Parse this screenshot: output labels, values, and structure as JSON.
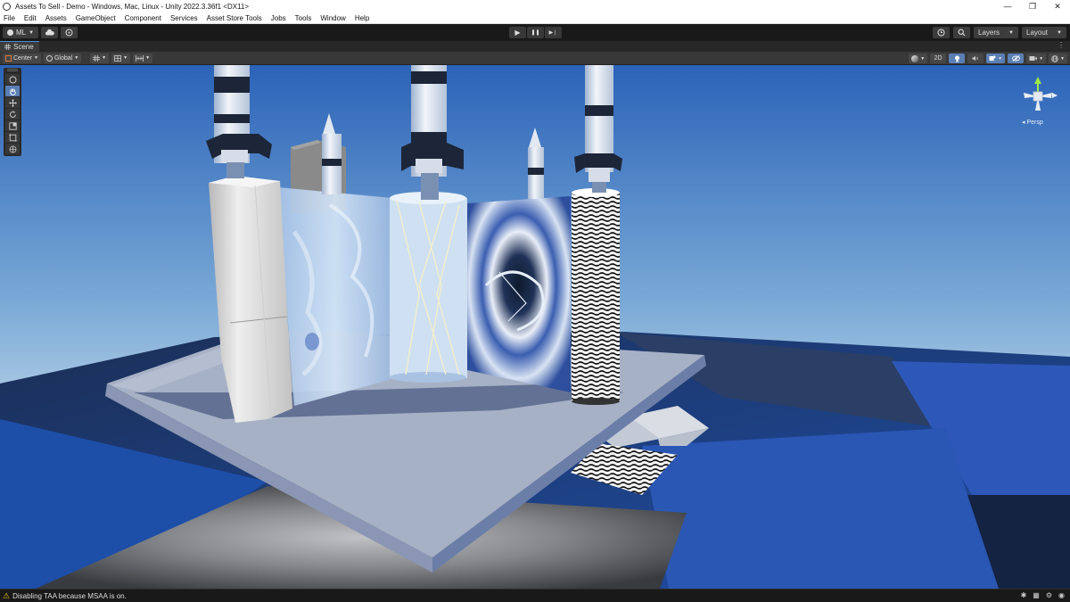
{
  "window": {
    "title": "Assets To Sell - Demo - Windows, Mac, Linux - Unity 2022.3.36f1 <DX11>",
    "minimize": "—",
    "restore": "❐",
    "close": "✕"
  },
  "menu": [
    "File",
    "Edit",
    "Assets",
    "GameObject",
    "Component",
    "Services",
    "Asset Store Tools",
    "Jobs",
    "Tools",
    "Window",
    "Help"
  ],
  "toolbar": {
    "account_label": "ML",
    "play_icon": "▶",
    "pause_icon": "❚❚",
    "step_icon": "▶❘",
    "layers_label": "Layers",
    "layout_label": "Layout"
  },
  "scene_tab": {
    "label": "Scene",
    "icon": "grid-icon"
  },
  "scene_toolbar": {
    "pivot_label": "Center",
    "space_label": "Global",
    "mode_2d_label": "2D"
  },
  "gizmo": {
    "projection_label": "Persp"
  },
  "status": {
    "icon": "warning-icon",
    "message": "Disabling TAA because MSAA is on."
  },
  "colors": {
    "accent": "#5a7fb5",
    "warning": "#f1c40f",
    "editor_bg": "#191919"
  }
}
